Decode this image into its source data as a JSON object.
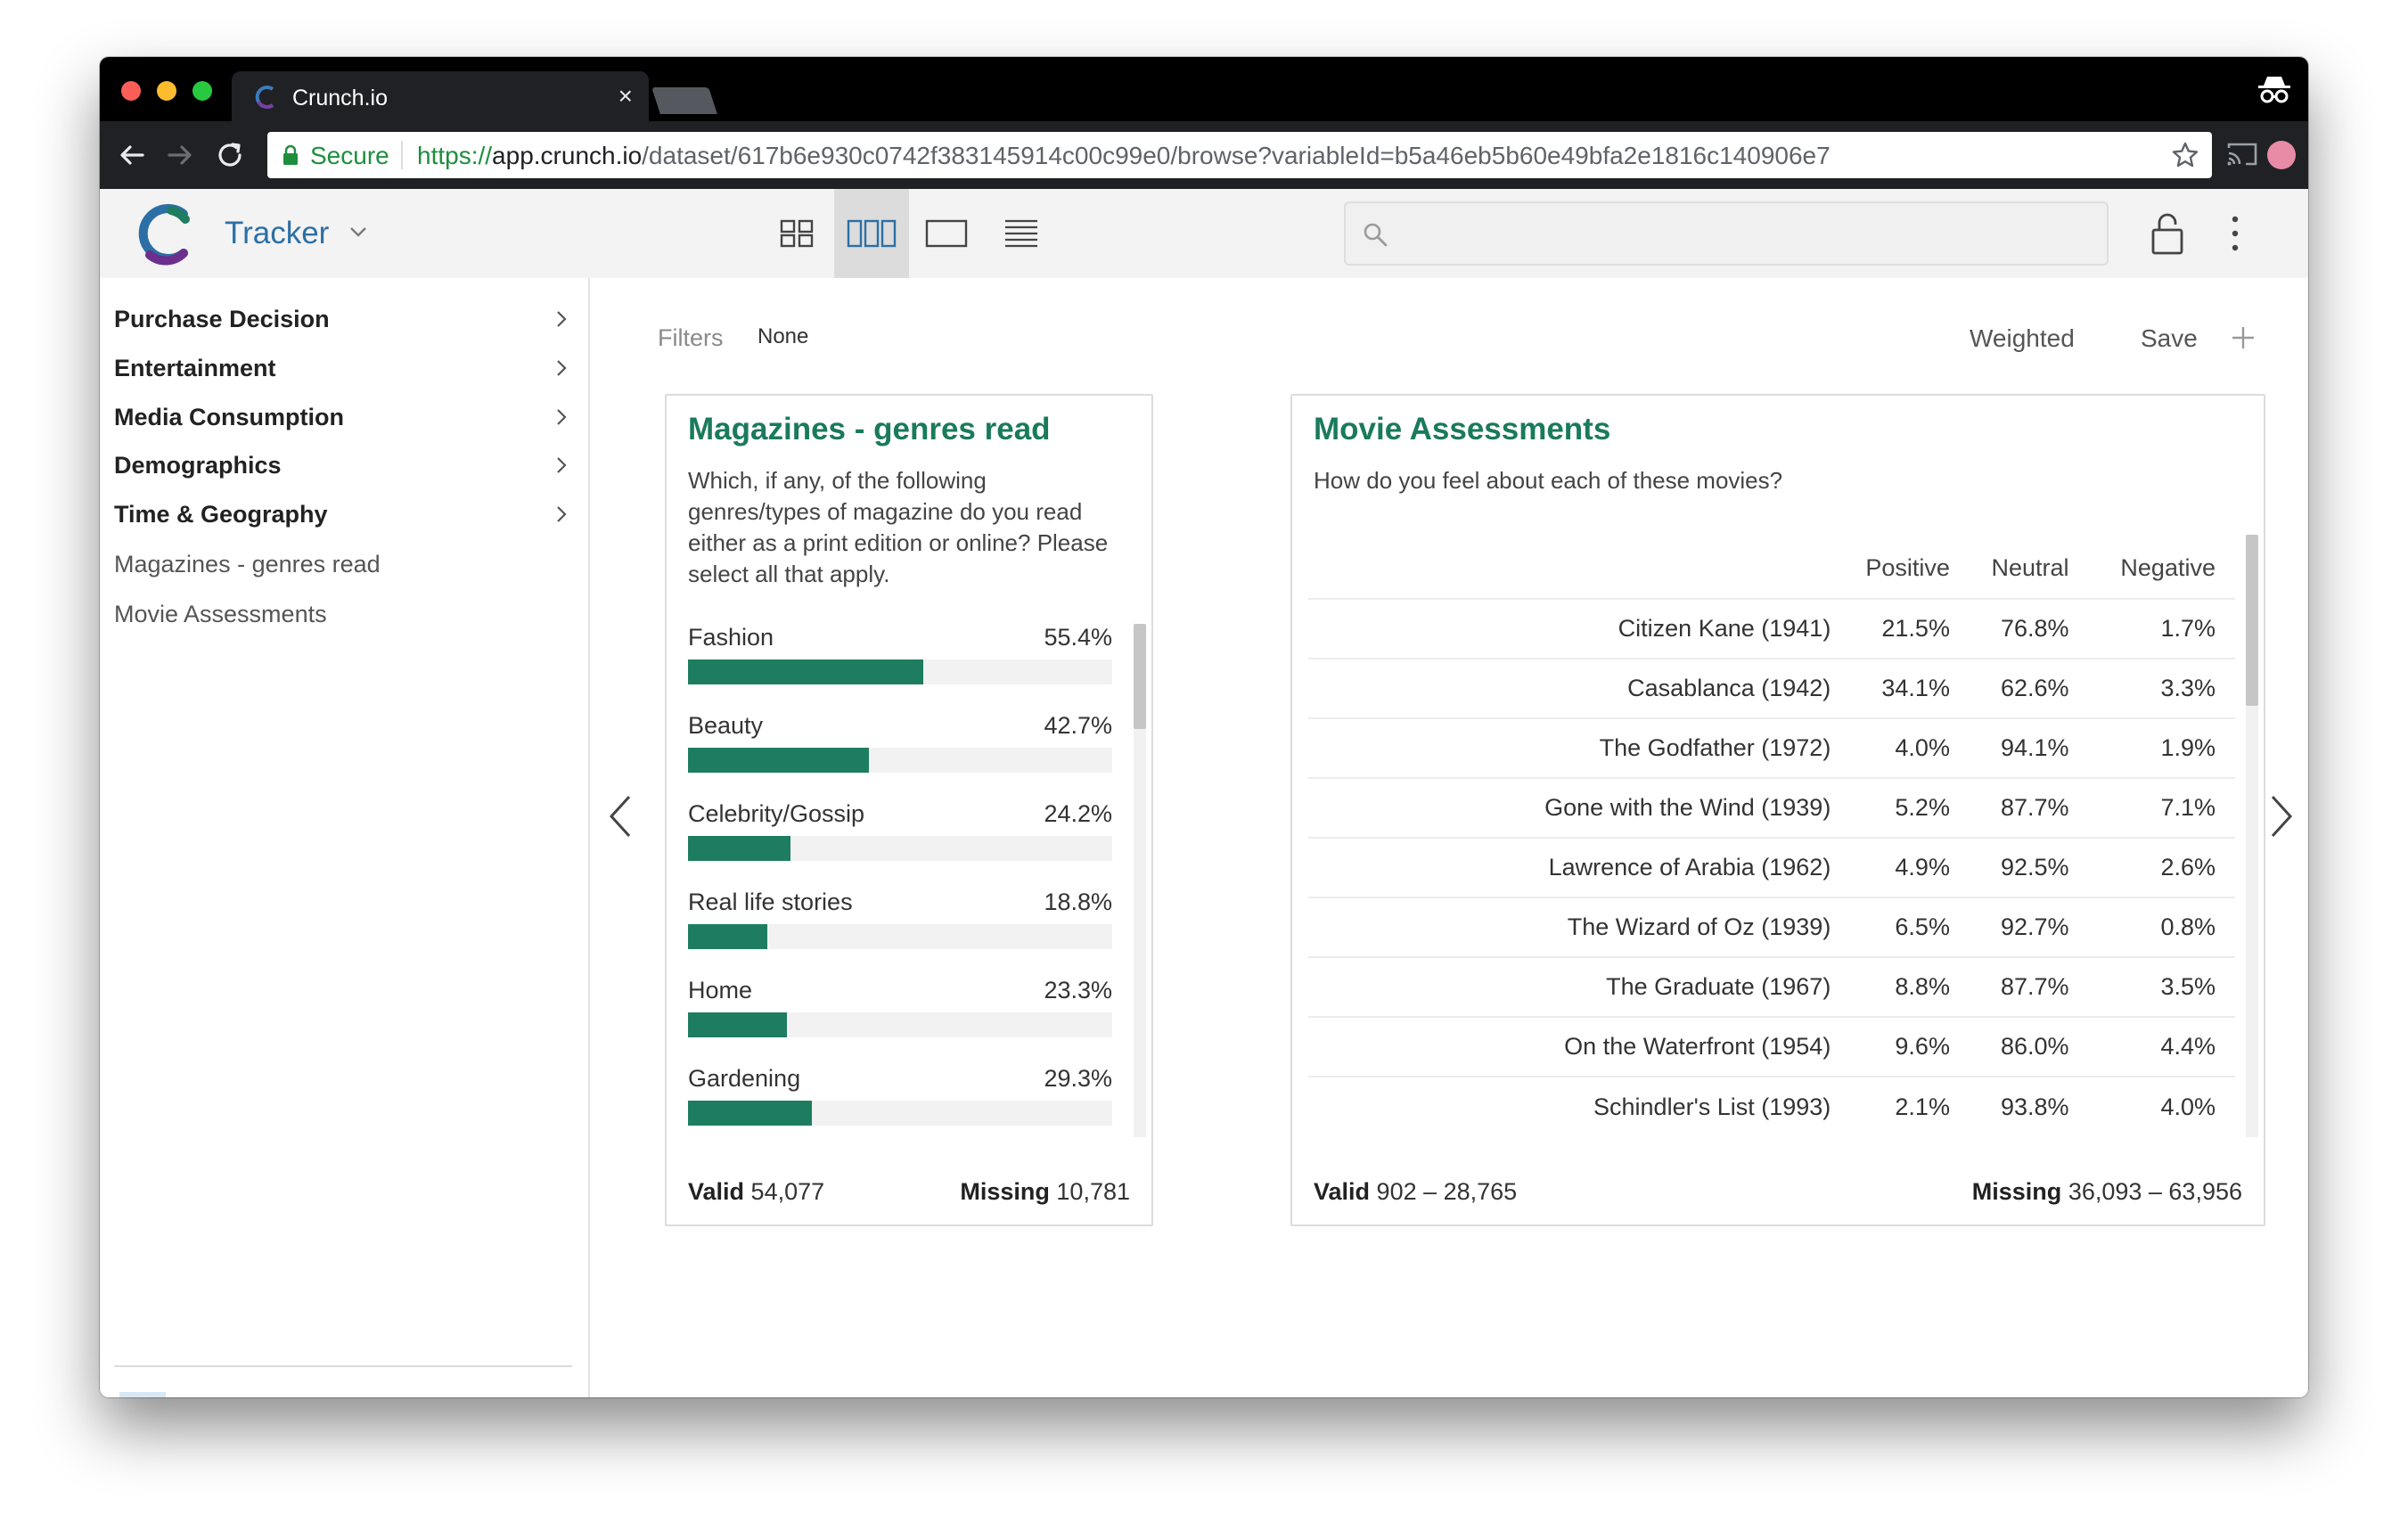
{
  "browser": {
    "tab_title": "Crunch.io",
    "tab_close": "×",
    "secure_label": "Secure",
    "url_scheme": "https://",
    "url_host": "app.crunch.io",
    "url_path": "/dataset/617b6e930c0742f383145914c00c99e0/browse?variableId=b5a46eb5b60e49bfa2e1816c140906e7"
  },
  "header": {
    "project_name": "Tracker",
    "search_placeholder": "",
    "views": [
      "grid-view-icon",
      "card-view-icon",
      "single-view-icon",
      "table-view-icon"
    ],
    "active_view": "card-view-icon"
  },
  "sidebar": {
    "folders": [
      {
        "label": "Purchase Decision"
      },
      {
        "label": "Entertainment"
      },
      {
        "label": "Media Consumption"
      },
      {
        "label": "Demographics"
      },
      {
        "label": "Time & Geography"
      }
    ],
    "variables": [
      {
        "label": "Magazines - genres read"
      },
      {
        "label": "Movie Assessments"
      }
    ],
    "add_button": "+"
  },
  "toolbar": {
    "filters_label": "Filters",
    "filters_value": "None",
    "weighted_label": "Weighted",
    "save_label": "Save"
  },
  "magazines_card": {
    "title": "Magazines - genres read",
    "question": "Which, if any, of the following genres/types of magazine do you read either as a print edition or online? Please select all that apply.",
    "bars": [
      {
        "label": "Fashion",
        "value_text": "55.4%",
        "value": 55.4
      },
      {
        "label": "Beauty",
        "value_text": "42.7%",
        "value": 42.7
      },
      {
        "label": "Celebrity/Gossip",
        "value_text": "24.2%",
        "value": 24.2
      },
      {
        "label": "Real life stories",
        "value_text": "18.8%",
        "value": 18.8
      },
      {
        "label": "Home",
        "value_text": "23.3%",
        "value": 23.3
      },
      {
        "label": "Gardening",
        "value_text": "29.3%",
        "value": 29.3
      }
    ],
    "valid_label": "Valid",
    "valid_value": "54,077",
    "missing_label": "Missing",
    "missing_value": "10,781"
  },
  "movies_card": {
    "title": "Movie Assessments",
    "question": "How do you feel about each of these movies?",
    "columns": [
      "Positive",
      "Neutral",
      "Negative"
    ],
    "rows": [
      {
        "name": "Citizen Kane (1941)",
        "positive": "21.5%",
        "neutral": "76.8%",
        "negative": "1.7%"
      },
      {
        "name": "Casablanca (1942)",
        "positive": "34.1%",
        "neutral": "62.6%",
        "negative": "3.3%"
      },
      {
        "name": "The Godfather (1972)",
        "positive": "4.0%",
        "neutral": "94.1%",
        "negative": "1.9%"
      },
      {
        "name": "Gone with the Wind (1939)",
        "positive": "5.2%",
        "neutral": "87.7%",
        "negative": "7.1%"
      },
      {
        "name": "Lawrence of Arabia (1962)",
        "positive": "4.9%",
        "neutral": "92.5%",
        "negative": "2.6%"
      },
      {
        "name": "The Wizard of Oz (1939)",
        "positive": "6.5%",
        "neutral": "92.7%",
        "negative": "0.8%"
      },
      {
        "name": "The Graduate (1967)",
        "positive": "8.8%",
        "neutral": "87.7%",
        "negative": "3.5%"
      },
      {
        "name": "On the Waterfront (1954)",
        "positive": "9.6%",
        "neutral": "86.0%",
        "negative": "4.4%"
      },
      {
        "name": "Schindler's List (1993)",
        "positive": "2.1%",
        "neutral": "93.8%",
        "negative": "4.0%"
      }
    ],
    "valid_label": "Valid",
    "valid_value": "902 – 28,765",
    "missing_label": "Missing",
    "missing_value": "36,093 – 63,956"
  },
  "colors": {
    "accent_green": "#1e7d60",
    "title_green": "#1a7a5c",
    "project_blue": "#2c6fa5",
    "secure_green": "#1e8e3e"
  }
}
